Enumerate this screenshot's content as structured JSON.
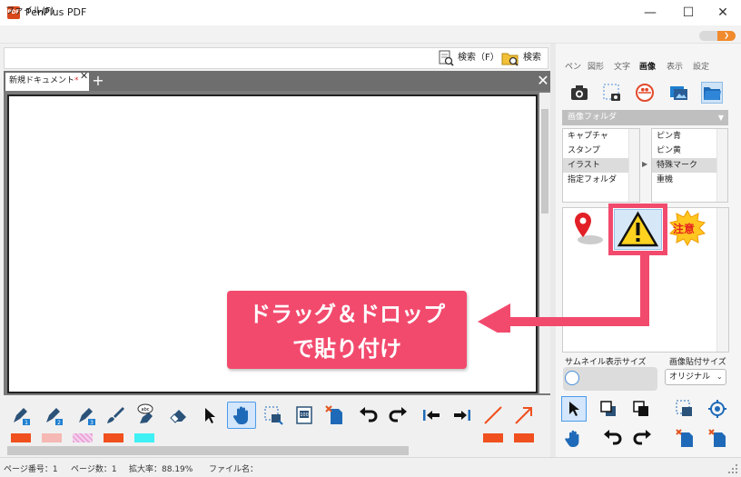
{
  "app": {
    "title": "PenPlus PDF",
    "icon_text": "PDF"
  },
  "window": {
    "minimize": "—",
    "maximize": "☐",
    "close": "✕"
  },
  "menu": {
    "file": "ファイル(F)"
  },
  "search": {
    "search_f": "検索（F）",
    "search2": "検索"
  },
  "tabs": {
    "doc_tab": "新規ドキュメント",
    "modified_mark": "*",
    "close": "✕",
    "add": "+",
    "panel_close": "✕"
  },
  "right_tabs": [
    "ペン",
    "図形",
    "文字",
    "画像",
    "表示",
    "設定"
  ],
  "right_tabs_active": "画像",
  "folder_select": "画像フォルダ",
  "category_list": [
    "キャプチャ",
    "スタンプ",
    "イラスト",
    "指定フォルダ"
  ],
  "category_selected": "イラスト",
  "sub_list": [
    "ピン青",
    "ピン黄",
    "特殊マーク",
    "重機"
  ],
  "sub_selected": "特殊マーク",
  "thumbs": {
    "caution_text": "注意"
  },
  "callout": {
    "line1": "ドラッグ＆ドロップ",
    "line2": "で貼り付け"
  },
  "thumb_size_label": "サムネイル表示サイズ",
  "paste_size_label": "画像貼付サイズ",
  "paste_size_value": "オリジナル",
  "status": {
    "page_no": "ページ番号：1",
    "page_count": "ページ数：1",
    "zoom": "拡大率：88.19%",
    "file_name": "ファイル名："
  },
  "colors": {
    "accent": "#f24a6d",
    "swatch_1": "#f0501e",
    "swatch_2": "#f5b8b4",
    "swatch_3": "#e9a6d9",
    "swatch_4": "#f0501e",
    "swatch_5": "#3ff0f5",
    "swatch_6": "#f0501e",
    "swatch_7": "#f0501e"
  }
}
